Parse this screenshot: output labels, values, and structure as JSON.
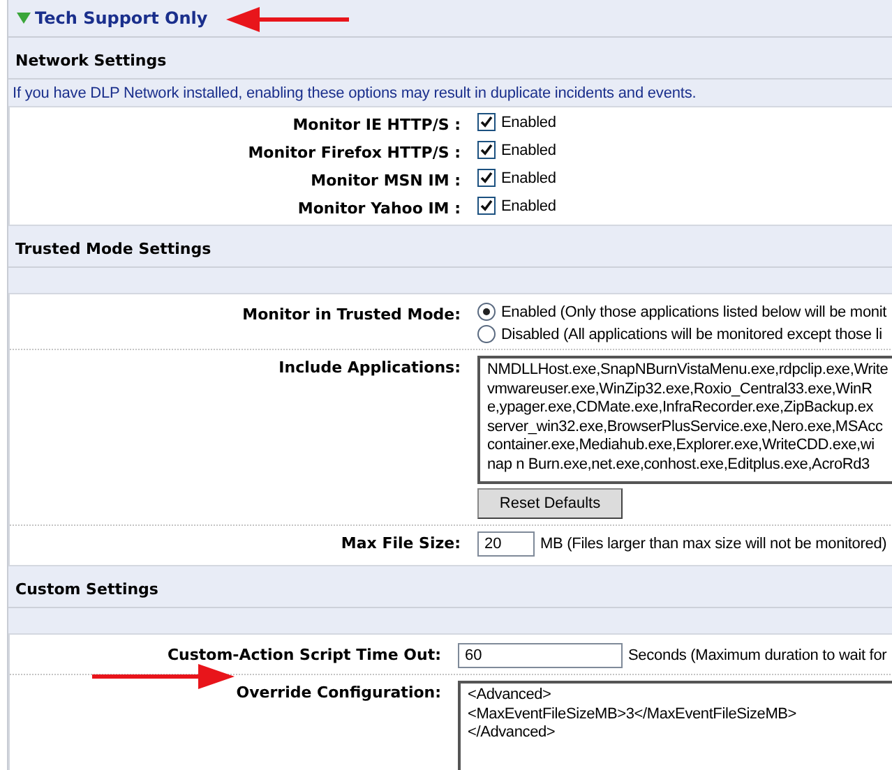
{
  "header": {
    "title": "Tech Support Only",
    "expanded": true
  },
  "sections": [
    {
      "title": "Network Settings",
      "note": "If you have DLP Network installed, enabling these options may result in duplicate incidents and events.",
      "rows": [
        {
          "kind": "checkbox",
          "label": "Monitor IE HTTP/S :",
          "checked": true,
          "text": "Enabled"
        },
        {
          "kind": "checkbox",
          "label": "Monitor Firefox HTTP/S :",
          "checked": true,
          "text": "Enabled"
        },
        {
          "kind": "checkbox",
          "label": "Monitor MSN IM :",
          "checked": true,
          "text": "Enabled"
        },
        {
          "kind": "checkbox",
          "label": "Monitor Yahoo IM :",
          "checked": true,
          "text": "Enabled"
        }
      ]
    },
    {
      "title": "Trusted Mode Settings",
      "rows": [
        {
          "kind": "radio",
          "label": "Monitor in Trusted Mode:",
          "options": [
            {
              "label": "Enabled (Only those applications listed below will be monit",
              "selected": true
            },
            {
              "label": "Disabled (All applications will be monitored except those li",
              "selected": false
            }
          ]
        },
        {
          "kind": "textarea",
          "label": "Include Applications:",
          "value": "NMDLLHost.exe,SnapNBurnVistaMenu.exe,rdpclip.exe,Write\nvmwareuser.exe,WinZip32.exe,Roxio_Central33.exe,WinR\ne,ypager.exe,CDMate.exe,InfraRecorder.exe,ZipBackup.ex\nserver_win32.exe,BrowserPlusService.exe,Nero.exe,MSAcc\ncontainer.exe,Mediahub.exe,Explorer.exe,WriteCDD.exe,wi\nnap n Burn.exe,net.exe,conhost.exe,Editplus.exe,AcroRd3",
          "button": "Reset Defaults"
        },
        {
          "kind": "input",
          "label": "Max File Size:",
          "value": "20",
          "suffix": "MB (Files larger than max size will not be monitored)"
        }
      ]
    },
    {
      "title": "Custom Settings",
      "rows": [
        {
          "kind": "input",
          "label": "Custom-Action Script Time Out:",
          "value": "60",
          "suffix": "Seconds (Maximum duration to wait for"
        },
        {
          "kind": "textarea",
          "label": "Override Configuration:",
          "value": "<Advanced>\n<MaxEventFileSizeMB>3</MaxEventFileSizeMB>\n</Advanced>"
        }
      ]
    }
  ]
}
